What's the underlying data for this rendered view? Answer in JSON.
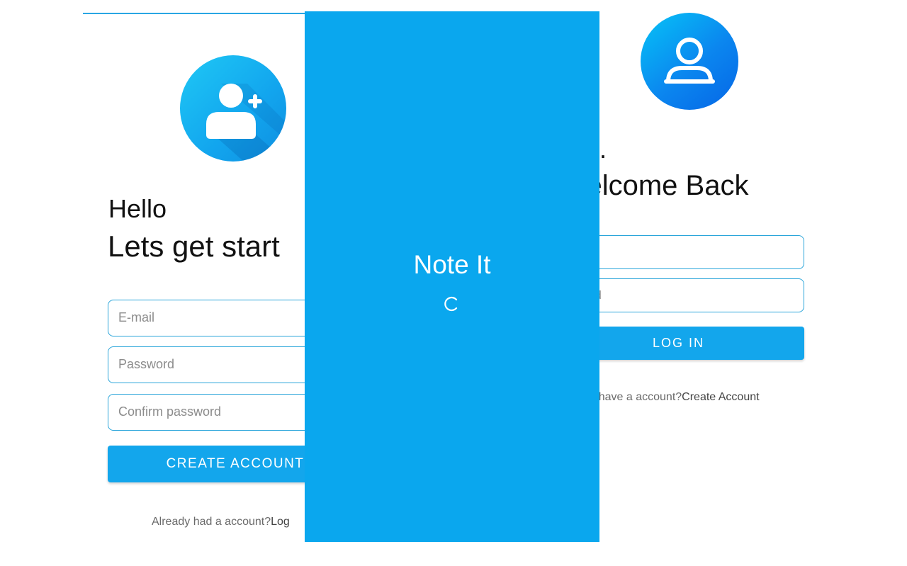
{
  "signup": {
    "greeting": "Hello",
    "headline": "Lets get start",
    "email_placeholder": "E-mail",
    "password_placeholder": "Password",
    "confirm_placeholder": "Confirm password",
    "create_button": "CREATE ACCOUNT",
    "footer_text": "Already had a account?",
    "footer_link": "Log"
  },
  "splash": {
    "app_name": "Note It"
  },
  "login": {
    "greeting": "i..",
    "headline": "Velcome Back",
    "email_placeholder": "mail",
    "password_placeholder": "ssword",
    "login_button": "LOG IN",
    "footer_text": "on't have a account?",
    "footer_link": "Create Account"
  },
  "colors": {
    "accent": "#13a6ec",
    "splash_bg": "#0aa7ee",
    "field_border": "#2aa5da"
  },
  "icons": {
    "signup_avatar": "add-user-icon",
    "login_avatar": "user-icon",
    "loading": "spinner-icon"
  }
}
